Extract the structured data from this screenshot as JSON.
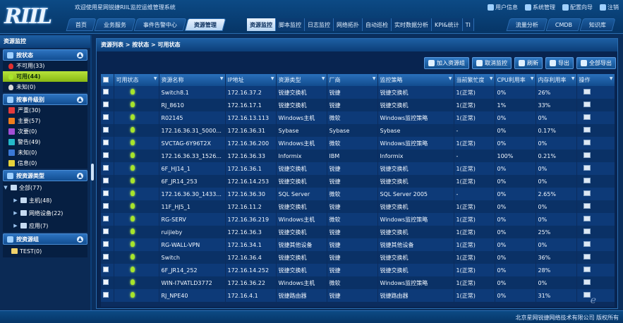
{
  "app": {
    "welcome": "欢迎使用星网锐捷RIIL监控运维管理系统",
    "logo": "RIIL"
  },
  "toplinks": [
    {
      "label": "用户信息",
      "icon": "user-info-icon"
    },
    {
      "label": "系统管理",
      "icon": "gear-icon"
    },
    {
      "label": "配置向导",
      "icon": "wizard-icon"
    },
    {
      "label": "注销",
      "icon": "logout-icon"
    }
  ],
  "main_tabs": [
    "首页",
    "业务服务",
    "事件告警中心",
    "资源管理"
  ],
  "main_active": 3,
  "sub_tabs": [
    "资源监控",
    "脚本监控",
    "日志监控",
    "网络拓扑",
    "自动巡检",
    "实时数据分析",
    "KPI&统计",
    "TI"
  ],
  "sub_active": 0,
  "main_tabs_right": [
    "流量分析",
    "CMDB",
    "知识库"
  ],
  "sidebar": {
    "title": "资源监控",
    "by_status": {
      "title": "按状态",
      "items": [
        {
          "label": "不可用(33)",
          "color": "#e03030"
        },
        {
          "label": "可用(44)",
          "color": "#a7e52a"
        },
        {
          "label": "未知(0)",
          "color": "#d8d8d8"
        }
      ],
      "selected": 1
    },
    "by_level": {
      "title": "按事件级别",
      "items": [
        {
          "label": "严重(30)",
          "color": "#e53b3b"
        },
        {
          "label": "主要(57)",
          "color": "#f07e1c"
        },
        {
          "label": "次要(0)",
          "color": "#a34fd6"
        },
        {
          "label": "警告(49)",
          "color": "#24b9c9"
        },
        {
          "label": "未知(0)",
          "color": "#3a78d6"
        },
        {
          "label": "信息(0)",
          "color": "#e7d23a"
        }
      ]
    },
    "by_type": {
      "title": "按资源类型",
      "root": "全部(77)",
      "children": [
        "主机(48)",
        "网络设备(22)",
        "应用(7)"
      ]
    },
    "by_group": {
      "title": "按资源组",
      "items": [
        "TEST(0)"
      ]
    }
  },
  "breadcrumb": "资源列表 > 按状态 > 可用状态",
  "toolbar": [
    {
      "label": "加入资源组",
      "icon": "add-group-icon"
    },
    {
      "label": "取消监控",
      "icon": "cancel-monitor-icon"
    },
    {
      "label": "刷新",
      "icon": "refresh-icon"
    },
    {
      "label": "导出",
      "icon": "export-icon"
    },
    {
      "label": "全部导出",
      "icon": "export-all-icon"
    }
  ],
  "columns": [
    "可用状态",
    "资源名称",
    "IP地址",
    "资源类型",
    "厂商",
    "监控策略",
    "当前繁忙度",
    "CPU利用率",
    "内存利用率",
    "操作"
  ],
  "rows": [
    [
      "Switch8.1",
      "172.16.37.2",
      "锐捷交换机",
      "锐捷",
      "锐捷交换机",
      "1(正常)",
      "0%",
      "26%"
    ],
    [
      "RJ_8610",
      "172.16.17.1",
      "锐捷交换机",
      "锐捷",
      "锐捷交换机",
      "1(正常)",
      "1%",
      "33%"
    ],
    [
      "R02145",
      "172.16.13.113",
      "Windows主机",
      "微软",
      "Windows监控策略",
      "1(正常)",
      "0%",
      "0%"
    ],
    [
      "172.16.36.31_5000...",
      "172.16.36.31",
      "Sybase",
      "Sybase",
      "Sybase",
      "-",
      "0%",
      "0.17%"
    ],
    [
      "SVCTAG-6Y96T2X",
      "172.16.36.200",
      "Windows主机",
      "微软",
      "Windows监控策略",
      "1(正常)",
      "0%",
      "0%"
    ],
    [
      "172.16.36.33_1526...",
      "172.16.36.33",
      "Informix",
      "IBM",
      "Informix",
      "-",
      "100%",
      "0.21%"
    ],
    [
      "6F_HJ14_1",
      "172.16.36.1",
      "锐捷交换机",
      "锐捷",
      "锐捷交换机",
      "1(正常)",
      "0%",
      "0%"
    ],
    [
      "6F_JR14_253",
      "172.16.14.253",
      "锐捷交换机",
      "锐捷",
      "锐捷交换机",
      "1(正常)",
      "0%",
      "0%"
    ],
    [
      "172.16.36.30_1433...",
      "172.16.36.30",
      "SQL Server",
      "微软",
      "SQL Server 2005",
      "-",
      "0%",
      "2.65%"
    ],
    [
      "11F_HJ5_1",
      "172.16.11.2",
      "锐捷交换机",
      "锐捷",
      "锐捷交换机",
      "1(正常)",
      "0%",
      "0%"
    ],
    [
      "RG-SERV",
      "172.16.36.219",
      "Windows主机",
      "微软",
      "Windows监控策略",
      "1(正常)",
      "0%",
      "0%"
    ],
    [
      "ruijieby",
      "172.16.36.3",
      "锐捷交换机",
      "锐捷",
      "锐捷交换机",
      "1(正常)",
      "0%",
      "25%"
    ],
    [
      "RG-WALL-VPN",
      "172.16.34.1",
      "锐捷其他设备",
      "锐捷",
      "锐捷其他设备",
      "1(正常)",
      "0%",
      "0%"
    ],
    [
      "Switch",
      "172.16.36.4",
      "锐捷交换机",
      "锐捷",
      "锐捷交换机",
      "1(正常)",
      "0%",
      "36%"
    ],
    [
      "6F_JR14_252",
      "172.16.14.252",
      "锐捷交换机",
      "锐捷",
      "锐捷交换机",
      "1(正常)",
      "0%",
      "28%"
    ],
    [
      "WIN-I7VATLD3772",
      "172.16.36.22",
      "Windows主机",
      "微软",
      "Windows监控策略",
      "1(正常)",
      "0%",
      "0%"
    ],
    [
      "RJ_NPE40",
      "172.16.4.1",
      "锐捷路由器",
      "锐捷",
      "锐捷路由器",
      "1(正常)",
      "0%",
      "31%"
    ]
  ],
  "footer": "北京星网锐捷网络技术有限公司 版权所有",
  "watermark": "e"
}
